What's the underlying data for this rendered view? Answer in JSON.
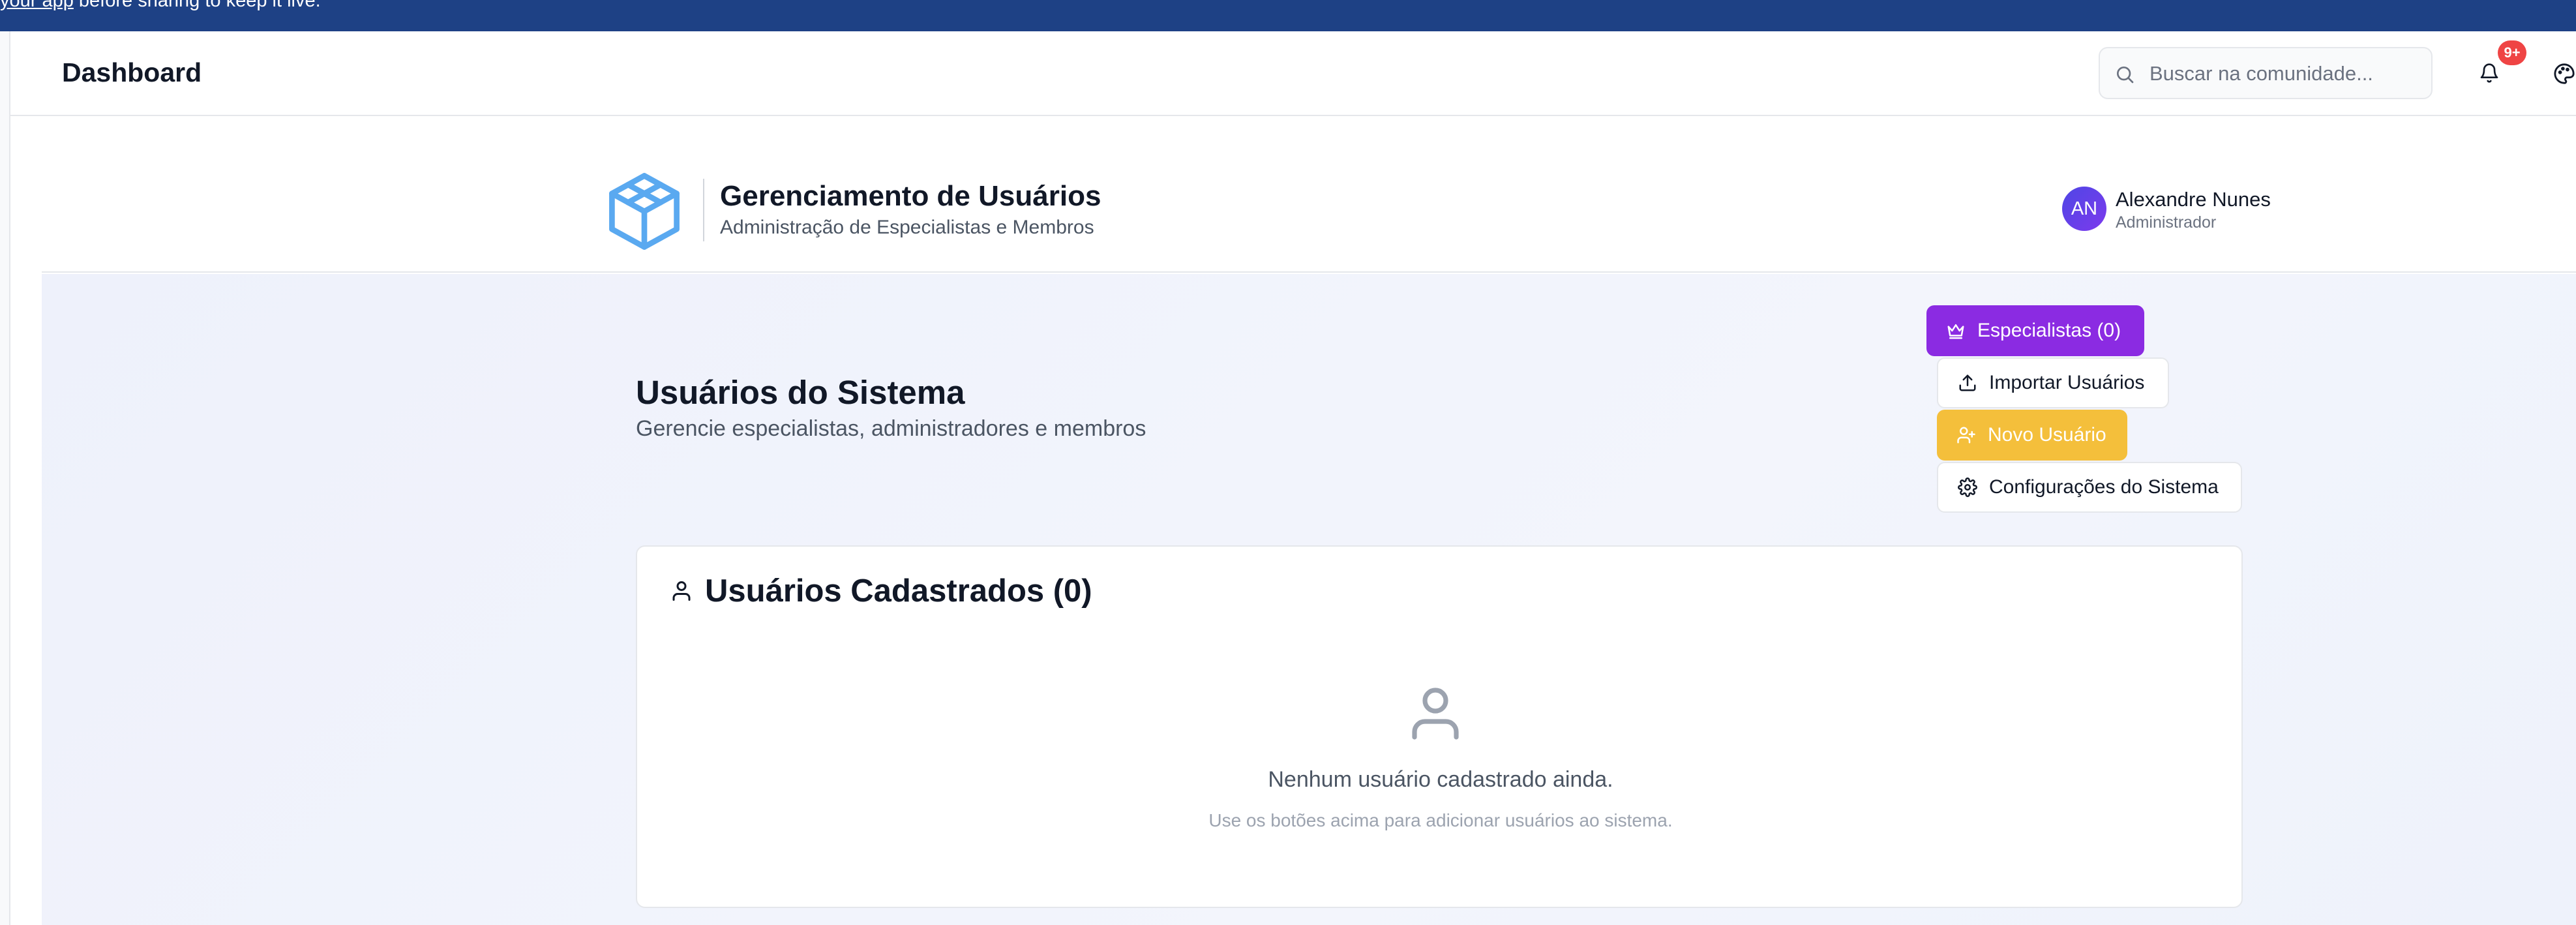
{
  "banner": {
    "link_text": "your app",
    "text": " before sharing to keep it live."
  },
  "header": {
    "title": "Dashboard",
    "search_placeholder": "Buscar na comunidade...",
    "notification_count": "9+"
  },
  "subheader": {
    "title": "Gerenciamento de Usuários",
    "subtitle": "Administração de Especialistas e Membros",
    "user": {
      "initials": "AN",
      "name": "Alexandre Nunes",
      "role": "Administrador"
    }
  },
  "main": {
    "title": "Usuários do Sistema",
    "subtitle": "Gerencie especialistas, administradores e membros",
    "actions": {
      "especialistas": "Especialistas (0)",
      "importar": "Importar Usuários",
      "novo": "Novo Usuário",
      "config": "Configurações do Sistema"
    },
    "card": {
      "title": "Usuários Cadastrados (0)",
      "empty_title": "Nenhum usuário cadastrado ainda.",
      "empty_text": "Use os botões acima para adicionar usuários ao sistema."
    }
  },
  "colors": {
    "banner": "#1e4185",
    "primary_purple": "#8b2be2",
    "accent_yellow": "#f4bf3b",
    "badge_red": "#ef4444",
    "logo_blue": "#5aa9f0"
  }
}
